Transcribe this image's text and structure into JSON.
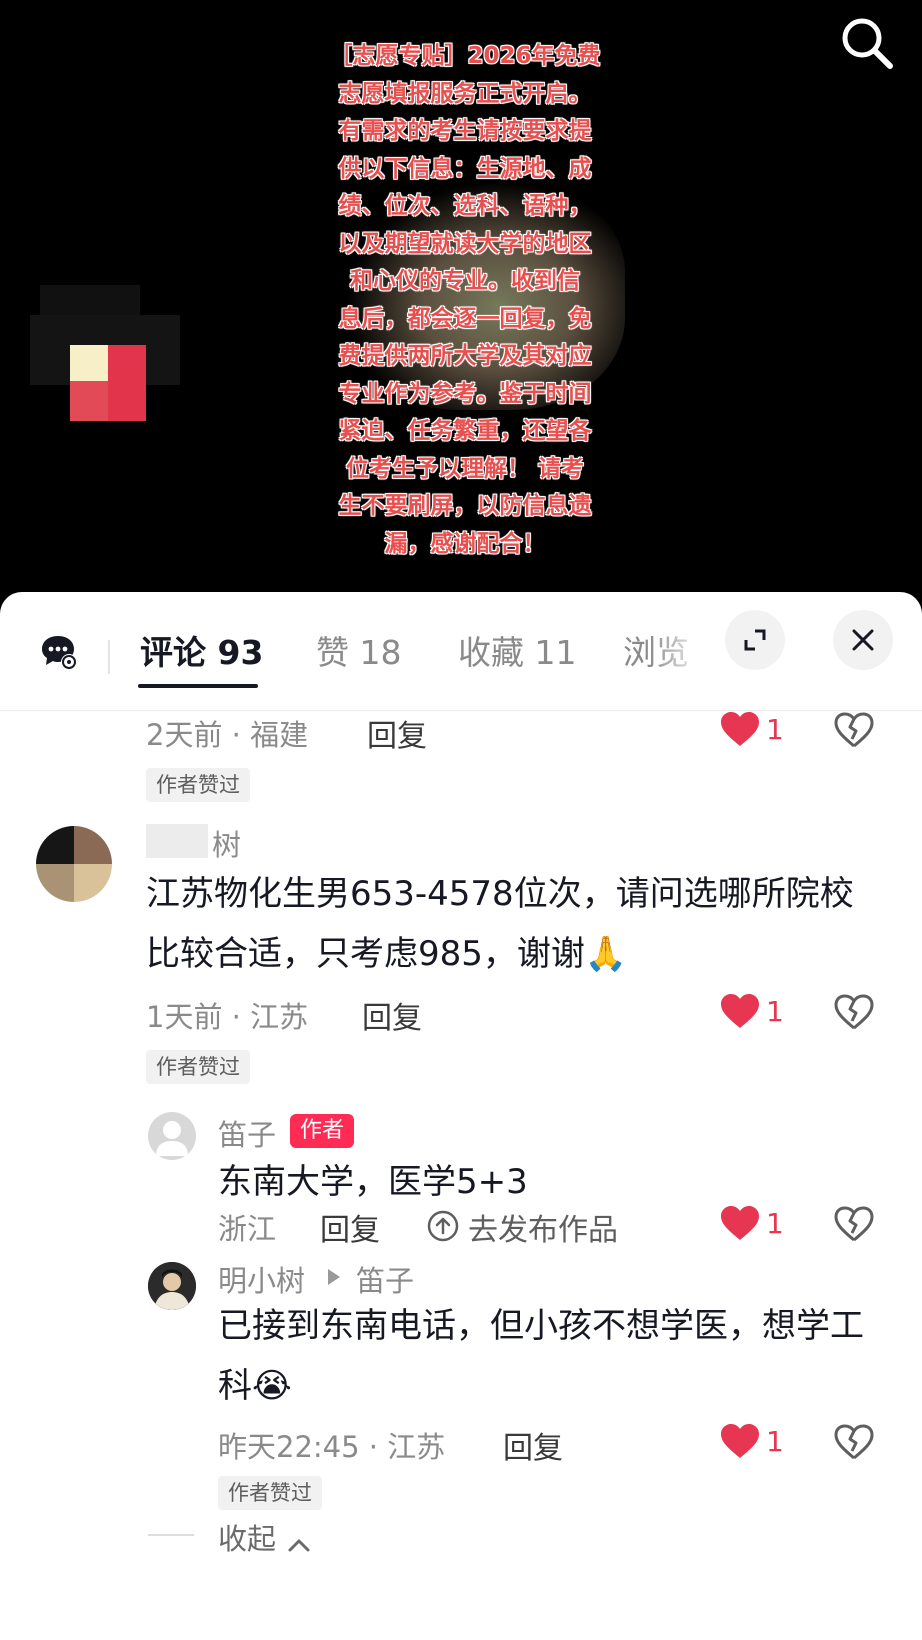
{
  "video": {
    "poster_text": "［志愿专贴］2026年免费\n志愿填报服务正式开启。\n有需求的考生请按要求提\n供以下信息：生源地、成\n绩、位次、选科、语种，\n以及期望就读大学的地区\n和心仪的专业。收到信\n息后，都会逐一回复，免\n费提供两所大学及其对应\n专业作为参考。鉴于时间\n紧迫、任务繁重，还望各\n位考生予以理解！ 请考\n生不要刷屏，以防信息遗\n漏，感谢配合！",
    "search_icon": "search-icon"
  },
  "tabs": {
    "comments": "评论 93",
    "likes": "赞 18",
    "favorites": "收藏 11",
    "views": "浏览"
  },
  "comments": [
    {
      "time_location": "2天前 · 福建",
      "reply_label": "回复",
      "like_count": "1",
      "author_liked": "作者赞过"
    },
    {
      "username": "树",
      "text": "江苏物化生男653-4578位次，请问选哪所院校比较合适，只考虑985，谢谢🙏",
      "time_location": "1天前 · 江苏",
      "reply_label": "回复",
      "like_count": "1",
      "author_liked": "作者赞过",
      "replies": [
        {
          "username": "笛子",
          "badge": "作者",
          "text": "东南大学，医学5+3",
          "location": "浙江",
          "reply_label": "回复",
          "publish_label": "去发布作品",
          "like_count": "1"
        },
        {
          "username": "明小树",
          "reply_to": "笛子",
          "text": "已接到东南电话，但小孩不想学医，想学工科😭",
          "time_location": "昨天22:45 · 江苏",
          "reply_label": "回复",
          "like_count": "1",
          "author_liked": "作者赞过"
        }
      ]
    }
  ],
  "collapse_label": "收起",
  "colors": {
    "like_red": "#e63651",
    "author_badge": "#fe2c55",
    "poster_text": "#e8504f"
  }
}
